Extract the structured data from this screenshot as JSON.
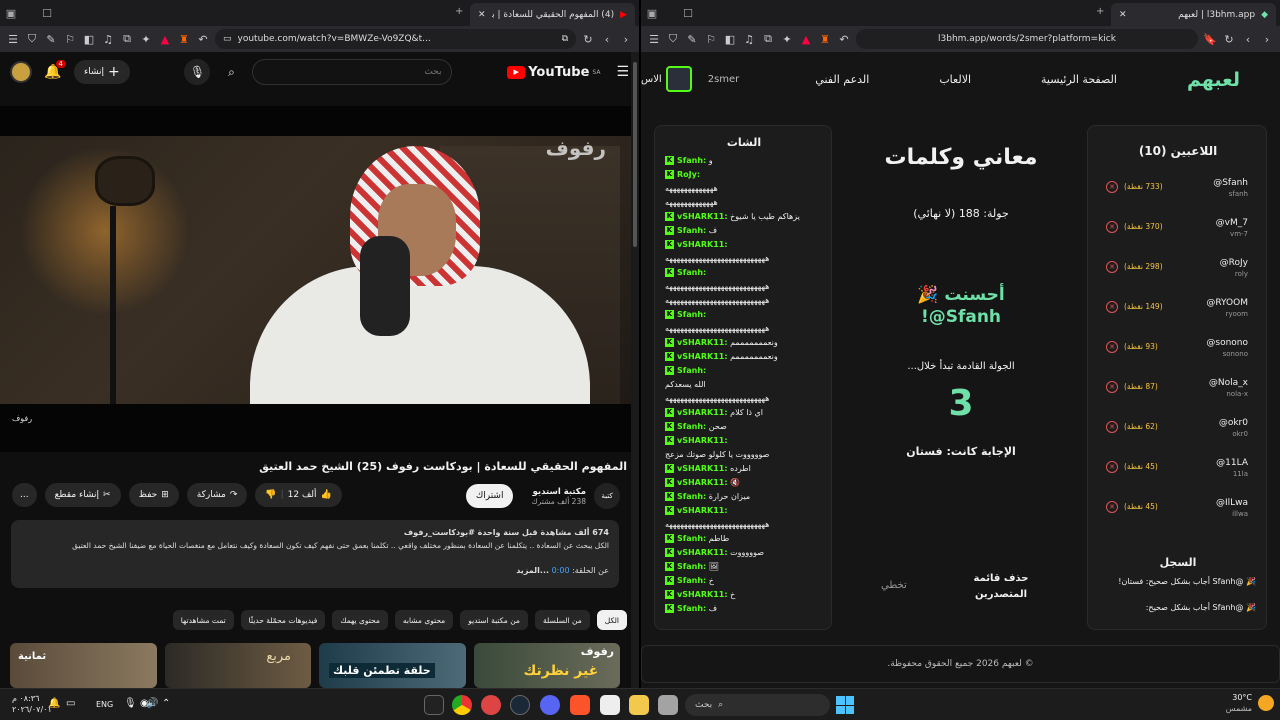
{
  "left": {
    "tab_title": "(4) المفهوم الحقيقي للسعادة | بود...",
    "url": "youtube.com/watch?v=BMWZe-Vo9ZQ&t...",
    "yt": {
      "logo": "YouTube",
      "logo_sup": "SA",
      "search_placeholder": "بحث",
      "create": "إنشاء",
      "notif_count": "4"
    },
    "video": {
      "watermark": "رفوف",
      "corner_label": "رفوف",
      "title": "المفهوم الحقيقي للسعادة | بودكاست رفوف (25) الشيخ حمد العتيق",
      "channel": "مكتبة استديو",
      "subscribers": "238 ألف مشترك",
      "channel_icon_label": "كتبة",
      "subscribe": "اشتراك",
      "likes": "12 ألف",
      "share": "مشاركة",
      "save": "حفظ",
      "clip": "إنشاء مقطع",
      "more": "..."
    },
    "description": {
      "meta": "674 ألف مشاهدة  قبل سنة واحدة  #بودكاست_رفوف",
      "text": "الكل يبحث عن السعادة .. يتكلمنا عن السعادة بمنظور مختلف واقعي .. تكلمنا بعمق حتى نفهم كيف تكون السعادة وكيف نتعامل مع منغصات الحياة مع ضيفنا الشيخ حمد العتيق",
      "chapter_prefix": "عن الحلقة:",
      "chapter_time": "0:00",
      "more": "...المزيد"
    },
    "chips": [
      "الكل",
      "من السلسلة",
      "من مكتبة استديو",
      "محتوى مشابه",
      "محتوى يهمك",
      "فيديوهات محمّلة حديثًا",
      "تمت مشاهدتها"
    ],
    "thumbs": [
      {
        "label": "رفوف",
        "text": "غير نظرتك"
      },
      {
        "label": "",
        "text": "حلقة تطمئن قلبك"
      },
      {
        "label": "",
        "text": "مربع"
      },
      {
        "label": "ثمانية",
        "text": ""
      }
    ]
  },
  "right": {
    "tab_title": "l3bhm.app | لعبهم",
    "url": "l3bhm.app/words/2smer?platform=kick",
    "nav": {
      "brand": "لعبهم",
      "home": "الصفحة الرئيسية",
      "games": "الالعاب",
      "support": "الدعم الفني",
      "user": "2smer",
      "extra": "الاس"
    },
    "players_title": "اللاعبين (10)",
    "players": [
      {
        "name": "@Sfanh",
        "user": "sfanh",
        "points": "(733 نقطة)"
      },
      {
        "name": "@vM_7",
        "user": "vm-7",
        "points": "(370 نقطة)"
      },
      {
        "name": "@RoJy",
        "user": "roly",
        "points": "(298 نقطة)"
      },
      {
        "name": "@RYOOM",
        "user": "ryoom",
        "points": "(149 نقطة)"
      },
      {
        "name": "@sonono",
        "user": "sonono",
        "points": "(93 نقطة)"
      },
      {
        "name": "@Nola_x",
        "user": "nola-x",
        "points": "(87 نقطة)"
      },
      {
        "name": "@okr0",
        "user": "okr0",
        "points": "(62 نقطة)"
      },
      {
        "name": "@11LA",
        "user": "11la",
        "points": "(45 نقطة)"
      },
      {
        "name": "@IlLwa",
        "user": "illwa",
        "points": "(45 نقطة)"
      }
    ],
    "log_title": "السجل",
    "log": [
      "🎉 @Sfanh أجاب بشكل صحيح: فستان!",
      "🎉 @Sfanh أجاب بشكل صحيح:"
    ],
    "game": {
      "title": "معاني وكلمات",
      "round": "جولة: 188 (لا نهائي)",
      "congrats": "أحسنت 🎉",
      "winner": "Sfanh@!",
      "next_round": "الجولة القادمة تبدأ خلال...",
      "countdown": "3",
      "answer": "الإجابة كانت: فستان",
      "delete_list": "حذف قائمة المتصدرين",
      "skip": "تخطي"
    },
    "chat_title": "الشات",
    "chat": [
      {
        "user": "Sfanh:",
        "msg": "و"
      },
      {
        "user": "RoJy:",
        "msg": ""
      },
      {
        "user": "",
        "msg": "هههههههههههههه"
      },
      {
        "user": "",
        "msg": "هههههههههههههه"
      },
      {
        "user": "vSHARK11:",
        "msg": "يزهاكم طيب يا شيوخ"
      },
      {
        "user": "Sfanh:",
        "msg": "ف"
      },
      {
        "user": "vSHARK11:",
        "msg": ""
      },
      {
        "user": "",
        "msg": "هههههههههههههههههههههههههههه"
      },
      {
        "user": "Sfanh:",
        "msg": ""
      },
      {
        "user": "",
        "msg": "هههههههههههههههههههههههههههه"
      },
      {
        "user": "",
        "msg": "هههههههههههههههههههههههههههه"
      },
      {
        "user": "Sfanh:",
        "msg": ""
      },
      {
        "user": "",
        "msg": "هههههههههههههههههههههههههههه"
      },
      {
        "user": "vSHARK11:",
        "msg": "ونعمممممممم"
      },
      {
        "user": "vSHARK11:",
        "msg": "ونعمممممممم"
      },
      {
        "user": "Sfanh:",
        "msg": ""
      },
      {
        "user": "",
        "msg": "الله يسعدكم"
      },
      {
        "user": "",
        "msg": "هههههههههههههههههههههههههههه"
      },
      {
        "user": "vSHARK11:",
        "msg": "اي ذا كلام"
      },
      {
        "user": "Sfanh:",
        "msg": "صحن"
      },
      {
        "user": "vSHARK11:",
        "msg": ""
      },
      {
        "user": "",
        "msg": "صوووووت يا كلولو صوتك مزعج"
      },
      {
        "user": "vSHARK11:",
        "msg": "اطرده"
      },
      {
        "user": "vSHARK11:",
        "msg": "🔇"
      },
      {
        "user": "Sfanh:",
        "msg": "ميزان حرارة"
      },
      {
        "user": "vSHARK11:",
        "msg": ""
      },
      {
        "user": "",
        "msg": "هههههههههههههههههههههههههههه"
      },
      {
        "user": "Sfanh:",
        "msg": "طاطم"
      },
      {
        "user": "vSHARK11:",
        "msg": "صوووووت"
      },
      {
        "user": "Sfanh:",
        "msg": "🖼"
      },
      {
        "user": "Sfanh:",
        "msg": "خ"
      },
      {
        "user": "vSHARK11:",
        "msg": "خ"
      },
      {
        "user": "Sfanh:",
        "msg": "ف"
      }
    ],
    "footer": "© لعبهم 2026 جميع الحقوق محفوظة."
  },
  "taskbar": {
    "weather_temp": "30°C",
    "weather_desc": "مشمس",
    "search": "بحث",
    "lang": "ENG",
    "time": "٠٨:٣٦ م",
    "date": "٢٠٢٦/٠٧/٠١"
  },
  "colors": {
    "youtube_red": "#ff0000",
    "kick_green": "#53fc18",
    "brand_green": "#6fe0a8",
    "points_gold": "#f5c542"
  }
}
